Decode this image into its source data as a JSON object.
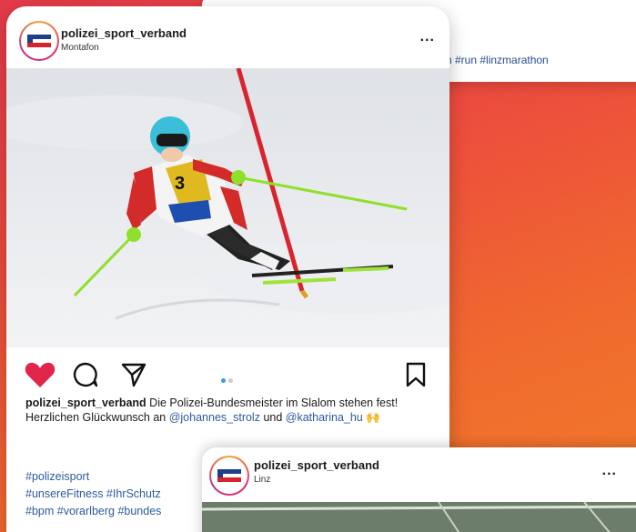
{
  "back_post": {
    "hashtags": "n #run #linzmarathon"
  },
  "main_post": {
    "username": "polizei_sport_verband",
    "location": "Montafon",
    "more_label": "...",
    "caption_user": "polizei_sport_verband",
    "caption_text_1": " Die Polizei-Bundesmeister im Slalom stehen fest! Herzlichen Glückwunsch an ",
    "mention_1": "@johannes_strolz",
    "caption_text_2": " und ",
    "mention_2": "@katharina_hu",
    "caption_emoji": " 🙌",
    "hashtag_lines": [
      "#polizeisport",
      "#unsereFitness #IhrSchutz",
      "#bpm #vorarlberg #bundes"
    ],
    "carousel_count": 2,
    "carousel_active": 0,
    "liked": true
  },
  "front_post": {
    "username": "polizei_sport_verband",
    "location": "Linz",
    "more_label": "..."
  },
  "colors": {
    "like_red": "#e0264a",
    "link_blue": "#2c5aa0",
    "carousel_active": "#3897f0"
  }
}
